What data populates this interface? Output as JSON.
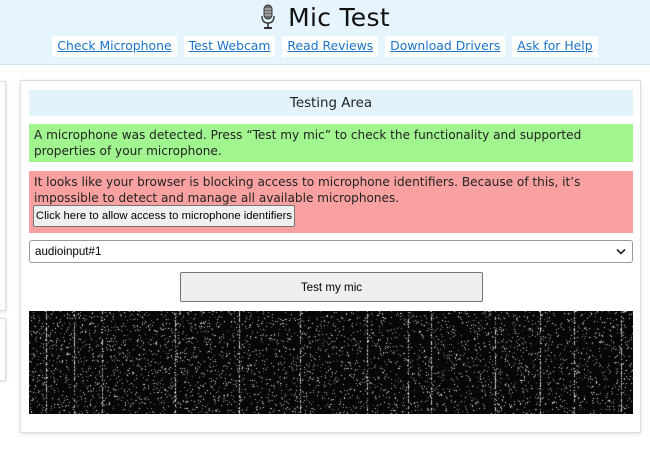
{
  "header": {
    "title": "Mic Test",
    "logo_icon": "microphone-icon",
    "nav": [
      "Check Microphone",
      "Test Webcam",
      "Read Reviews",
      "Download Drivers",
      "Ask for Help"
    ]
  },
  "testing": {
    "title": "Testing Area",
    "detected_message": "A microphone was detected. Press “Test my mic” to check the functionality and supported properties of your microphone.",
    "blocked_message": "It looks like your browser is blocking access to microphone identifiers. Because of this, it’s impossible to detect and manage all available microphones.",
    "allow_button": "Click here to allow access to microphone identifiers",
    "device_select_value": "audioinput#1",
    "test_button": "Test my mic"
  },
  "colors": {
    "header_bg": "#e6f5fd",
    "link": "#1a73c8",
    "success_bg": "#a0f58f",
    "error_bg": "#f9a1a1",
    "section_title_bg": "#e2f3fc",
    "visualizer_bg": "#070707"
  }
}
